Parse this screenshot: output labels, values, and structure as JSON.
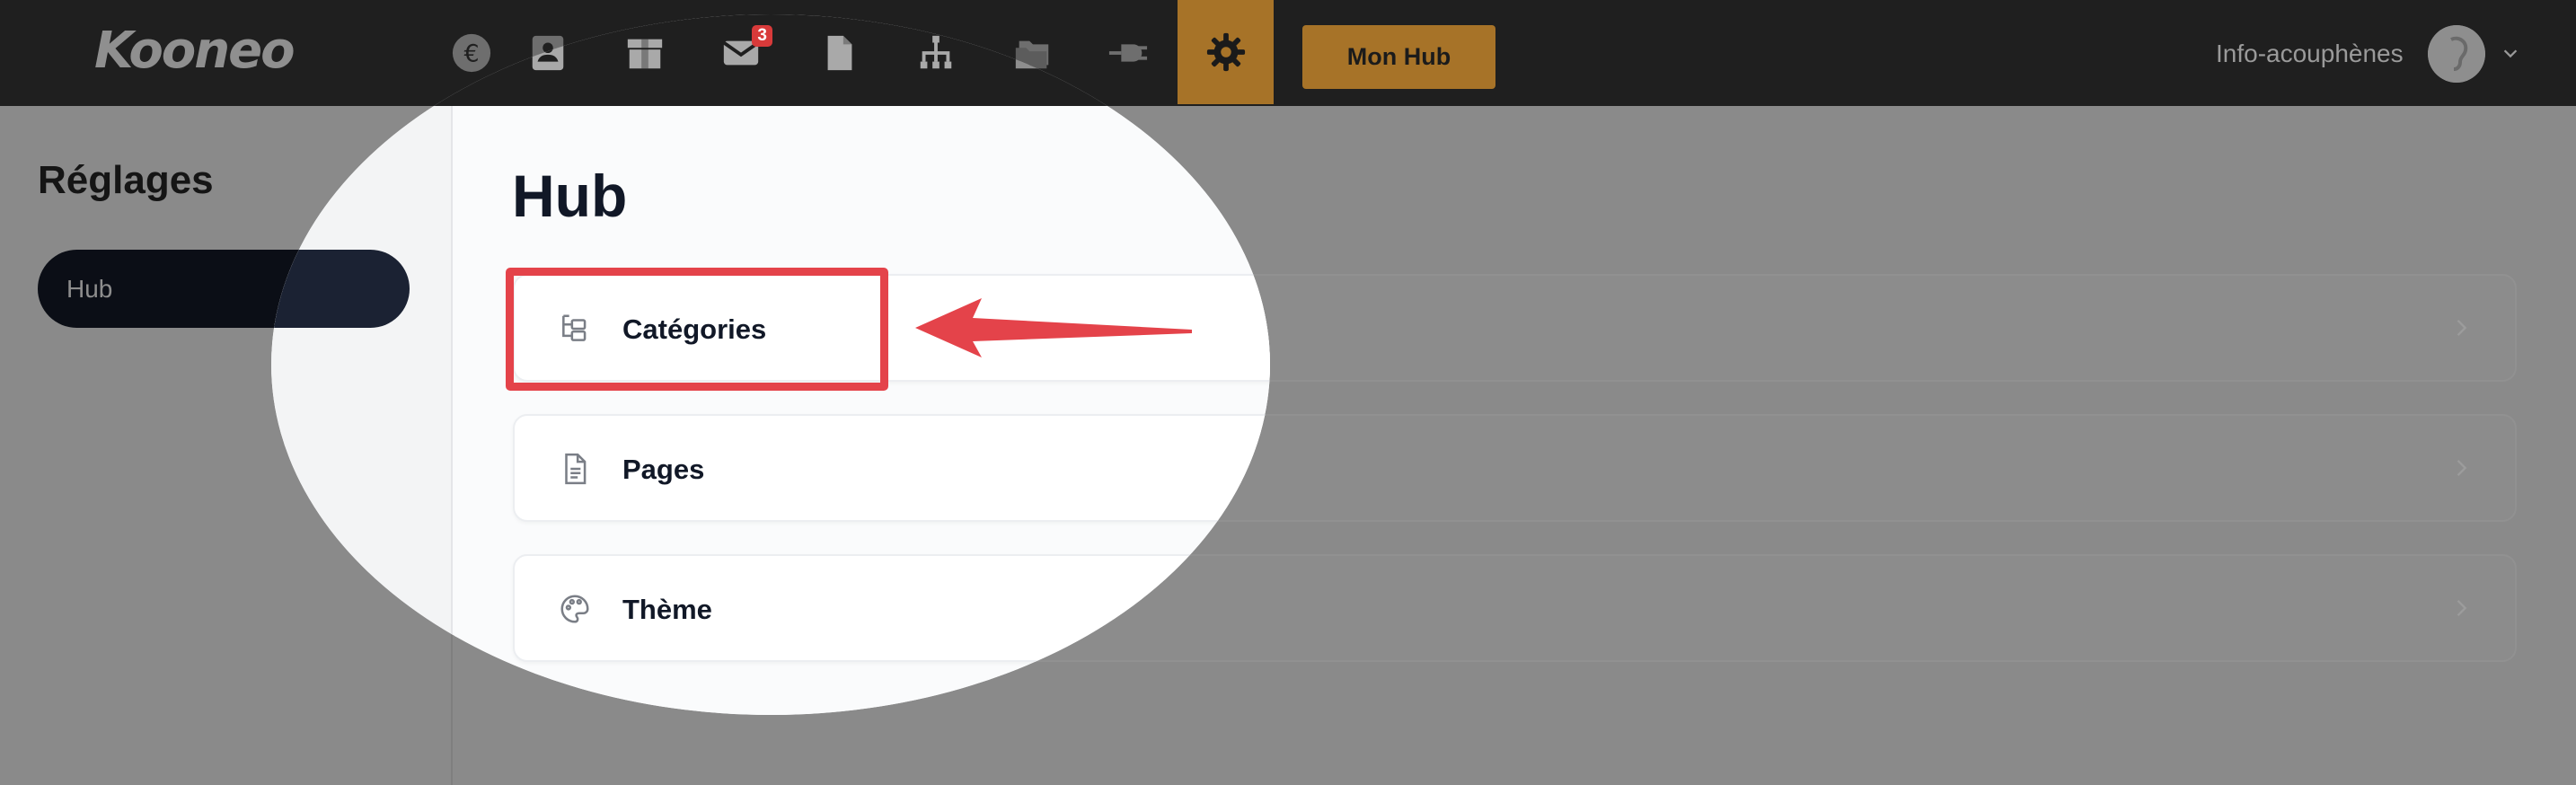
{
  "app": {
    "logo": "Kooneo"
  },
  "topbar": {
    "icons": [
      "euro-icon",
      "contact-card-icon",
      "package-icon",
      "mail-icon",
      "file-icon",
      "sitemap-icon",
      "folders-icon",
      "plug-icon",
      "gear-icon"
    ],
    "mail_badge": "3",
    "mon_hub_label": "Mon Hub",
    "account_name": "Info-acouphènes"
  },
  "sidebar": {
    "title": "Réglages",
    "items": [
      {
        "label": "Hub",
        "active": true
      }
    ]
  },
  "main": {
    "title": "Hub",
    "rows": [
      {
        "label": "Catégories",
        "icon": "category-tree-icon"
      },
      {
        "label": "Pages",
        "icon": "document-icon"
      },
      {
        "label": "Thème",
        "icon": "palette-icon"
      }
    ]
  },
  "colors": {
    "accent": "#a77328",
    "annotation": "#e4434a",
    "topbar_bg": "#1f1f1f",
    "overlay_bg": "#8a8a8a",
    "pill_bg": "#1b2233",
    "badge": "#d83a3a"
  }
}
